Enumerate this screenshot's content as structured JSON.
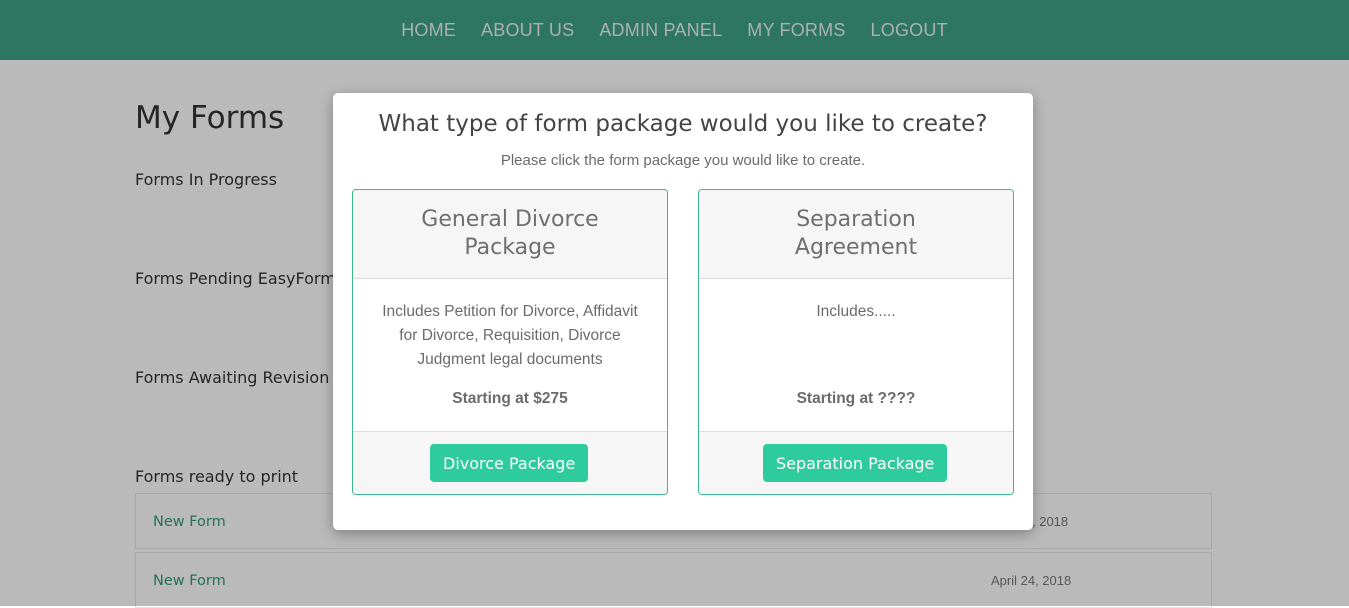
{
  "nav": {
    "items": [
      "HOME",
      "ABOUT US",
      "ADMIN PANEL",
      "MY FORMS",
      "LOGOUT"
    ]
  },
  "page": {
    "title": "My Forms",
    "sections": {
      "in_progress": "Forms In Progress",
      "pending": "Forms Pending EasyForm",
      "awaiting": "Forms Awaiting Revision",
      "ready": "Forms ready to print"
    },
    "forms": [
      {
        "name": "New Form",
        "date": ", 2018"
      },
      {
        "name": "New Form",
        "date": "April 24, 2018"
      }
    ]
  },
  "modal": {
    "title": "What type of form package would you like to create?",
    "subtitle": "Please click the form package you would like to create.",
    "cards": [
      {
        "title": "General Divorce Package",
        "description": "Includes Petition for Divorce, Affidavit for Divorce, Requisition, Divorce Judgment legal documents",
        "price": "Starting at $275",
        "button": "Divorce Package"
      },
      {
        "title": "Separation Agreement",
        "description": "Includes.....",
        "price": "Starting at ????",
        "button": "Separation Package"
      }
    ]
  },
  "colors": {
    "navbar": "#3fa283",
    "accent": "#2ecc9c",
    "link": "#2e9d78",
    "card_border": "#3fb590"
  }
}
